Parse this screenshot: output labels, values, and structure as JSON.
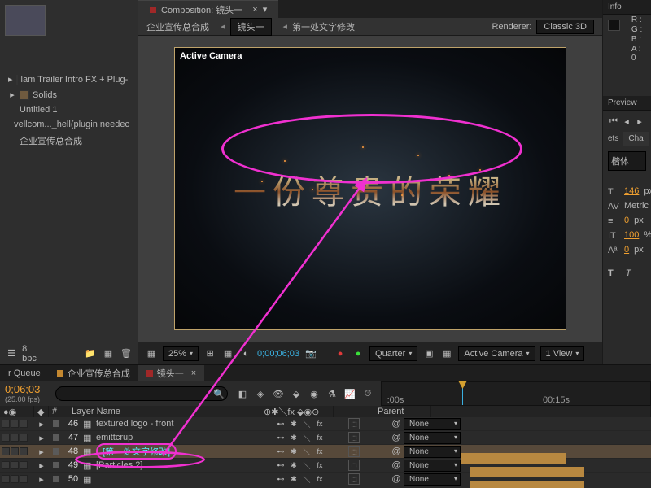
{
  "comp_tab_label": "Composition: 镜头一",
  "breadcrumb": {
    "root": "企业宣传总合成",
    "sel": "镜头一",
    "leaf": "第一处文字修改",
    "renderer_label": "Renderer:",
    "renderer_value": "Classic 3D"
  },
  "active_camera": "Active Camera",
  "hero_text": "一份尊贵的荣耀",
  "project": {
    "items": [
      {
        "label": "lam Trailer Intro FX + Plug-i",
        "tw": "▸",
        "folder": true
      },
      {
        "label": "Solids",
        "tw": "▸",
        "folder": true
      },
      {
        "label": "Untitled 1",
        "tw": "",
        "folder": false
      },
      {
        "label": "vellcom..._hell(plugin needec",
        "tw": "",
        "folder": false
      },
      {
        "label": "企业宣传总合成",
        "tw": "",
        "folder": false
      }
    ],
    "bpc": "8 bpc"
  },
  "view_controls": {
    "zoom": "25%",
    "timecode": "0;00;06;03",
    "quality": "Quarter",
    "camera": "Active Camera",
    "views": "1 View"
  },
  "info": {
    "title": "Info",
    "r": "R :",
    "g": "G :",
    "b": "B :",
    "a": "A : 0"
  },
  "preview": {
    "title": "Preview"
  },
  "char": {
    "tabs": [
      "ets",
      "Cha"
    ],
    "font": "楷体",
    "size": "146",
    "size_u": "px",
    "metrics": "Metric",
    "track": "0",
    "track_u": "px",
    "scale": "100",
    "scale_u": "%",
    "baseline": "0",
    "baseline_u": "px"
  },
  "timeline": {
    "tabs": [
      {
        "label": "r Queue",
        "active": false,
        "sq": false
      },
      {
        "label": "企业宣传总合成",
        "active": false,
        "sq": true
      },
      {
        "label": "镜头一",
        "active": true,
        "sq": true
      }
    ],
    "timecode": "0;06;03",
    "fps": "(25.00 fps)",
    "search_placeholder": "",
    "ruler": {
      "t0": ":00s",
      "t1": "00:15s",
      "cti_pct": 30
    },
    "columns": {
      "num": "#",
      "name": "Layer Name",
      "parent": "Parent"
    },
    "parent_none": "None",
    "layers": [
      {
        "n": "46",
        "name": "textured logo - front",
        "sel": false,
        "hi": false
      },
      {
        "n": "47",
        "name": "emittcrup",
        "sel": false,
        "hi": false
      },
      {
        "n": "48",
        "name": "[第一处文字修改]",
        "sel": true,
        "hi": true
      },
      {
        "n": "49",
        "name": "[Particles 2]",
        "sel": false,
        "hi": false
      },
      {
        "n": "50",
        "name": "",
        "sel": false,
        "hi": false
      }
    ]
  }
}
